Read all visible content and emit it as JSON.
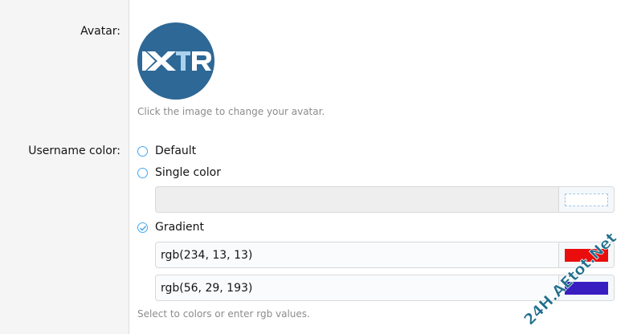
{
  "avatar": {
    "label": "Avatar:",
    "hint": "Click the image to change your avatar.",
    "logo_text": "XTR",
    "bg_color": "#2d6896"
  },
  "username_color": {
    "label": "Username color:",
    "options": [
      {
        "label": "Default",
        "checked": false
      },
      {
        "label": "Single color",
        "checked": false
      },
      {
        "label": "Gradient",
        "checked": true
      }
    ],
    "single_value": "",
    "gradient_values": [
      {
        "value": "rgb(234, 13, 13)",
        "swatch": "#ea0d0d"
      },
      {
        "value": "rgb(56, 29, 193)",
        "swatch": "#381dc1"
      }
    ],
    "hint": "Select to colors or enter rgb values."
  },
  "watermark": {
    "text": "24H.AEtot.Net",
    "color": "#1f6e8c"
  }
}
